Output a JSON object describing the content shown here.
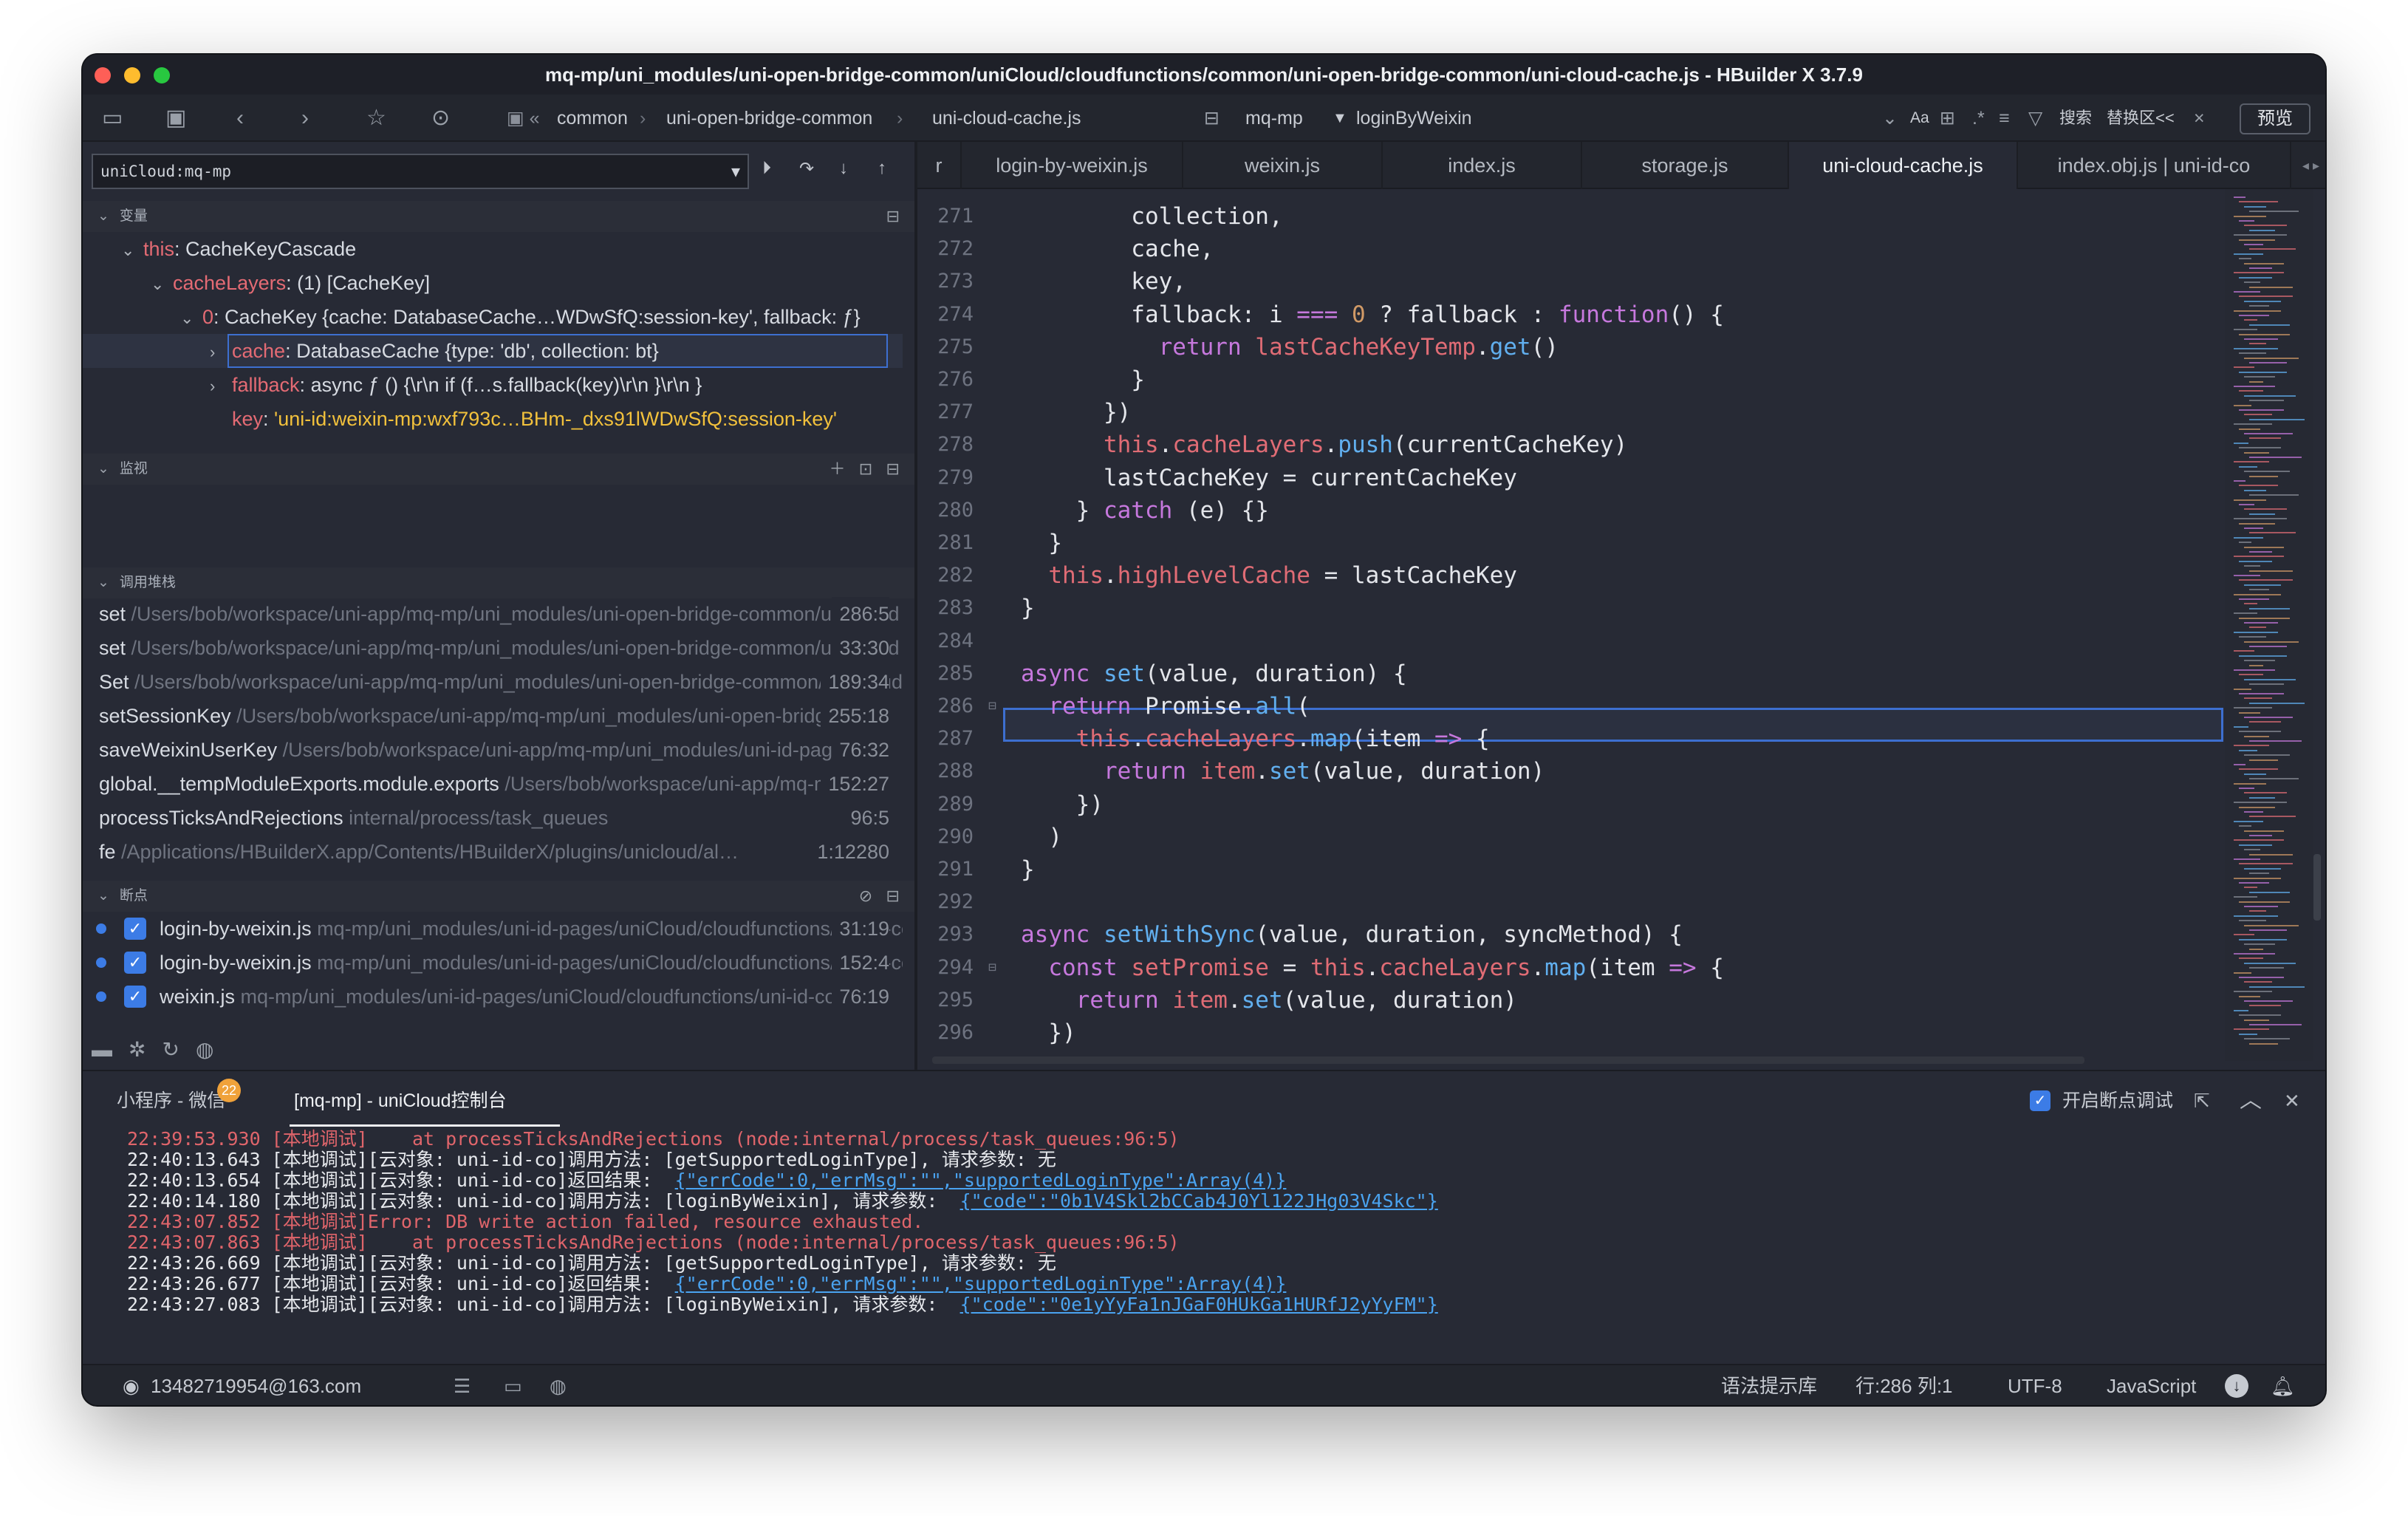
{
  "window": {
    "title": "mq-mp/uni_modules/uni-open-bridge-common/uniCloud/cloudfunctions/common/uni-open-bridge-common/uni-cloud-cache.js - HBuilder X 3.7.9"
  },
  "toolbar": {
    "breadcrumb": [
      "common",
      "uni-open-bridge-common",
      "uni-cloud-cache.js"
    ],
    "project": "mq-mp",
    "function": "loginByWeixin",
    "search_label": "搜索",
    "replace_label": "替换区<<",
    "preview_label": "预览",
    "font_label": "Aa"
  },
  "debug": {
    "target": "uniCloud:mq-mp",
    "sections": {
      "variables": "变量",
      "watch": "监视",
      "callstack": "调用堆栈",
      "breakpoints": "断点"
    },
    "variables": [
      {
        "key": "this",
        "val": "CacheKeyCascade",
        "indent": 0,
        "tw": "v"
      },
      {
        "key": "cacheLayers",
        "val": "(1) [CacheKey]",
        "indent": 1,
        "tw": "v"
      },
      {
        "key": "0",
        "val": "CacheKey {cache: DatabaseCache…WDwSfQ:session-key', fallback: ƒ}",
        "indent": 2,
        "tw": "v"
      },
      {
        "key": "cache",
        "val": "DatabaseCache {type: 'db', collection: bt}",
        "indent": 3,
        "tw": ">"
      },
      {
        "key": "fallback",
        "val": "async ƒ () {\\r\\n        if (f…s.fallback(key)\\r\\n        }\\r\\n      }",
        "indent": 3,
        "tw": ">"
      },
      {
        "key": "key",
        "val": "'uni-id:weixin-mp:wxf793c…BHm-_dxs91lWDwSfQ:session-key'",
        "indent": 3,
        "tw": ""
      }
    ],
    "callstack": [
      {
        "fn": "set",
        "path": "/Users/bob/workspace/uni-app/mq-mp/uni_modules/uni-open-bridge-common/uniCloud",
        "loc": "286:5"
      },
      {
        "fn": "set",
        "path": "/Users/bob/workspace/uni-app/mq-mp/uni_modules/uni-open-bridge-common/uniCloud",
        "loc": "33:30"
      },
      {
        "fn": "Set",
        "path": "/Users/bob/workspace/uni-app/mq-mp/uni_modules/uni-open-bridge-common/uniCloud",
        "loc": "189:34"
      },
      {
        "fn": "setSessionKey",
        "path": "/Users/bob/workspace/uni-app/mq-mp/uni_modules/uni-open-bridge",
        "loc": "255:18"
      },
      {
        "fn": "saveWeixinUserKey",
        "path": "/Users/bob/workspace/uni-app/mq-mp/uni_modules/uni-id-pages",
        "loc": "76:32"
      },
      {
        "fn": "global.__tempModuleExports.module.exports",
        "path": "/Users/bob/workspace/uni-app/mq-mp",
        "loc": "152:27"
      },
      {
        "fn": "processTicksAndRejections",
        "path": "internal/process/task_queues",
        "loc": "96:5"
      },
      {
        "fn": "fe",
        "path": "/Applications/HBuilderX.app/Contents/HBuilderX/plugins/unicloud/al…",
        "loc": "1:12280"
      }
    ],
    "breakpoints": [
      {
        "name": "login-by-weixin.js",
        "path": "mq-mp/uni_modules/uni-id-pages/uniCloud/cloudfunctions/uni-id-co",
        "loc": "31:19"
      },
      {
        "name": "login-by-weixin.js",
        "path": "mq-mp/uni_modules/uni-id-pages/uniCloud/cloudfunctions/uni-id-co",
        "loc": "152:4"
      },
      {
        "name": "weixin.js",
        "path": "mq-mp/uni_modules/uni-id-pages/uniCloud/cloudfunctions/uni-id-co",
        "loc": "76:19"
      }
    ]
  },
  "tabs": [
    {
      "label": "r",
      "active": false
    },
    {
      "label": "login-by-weixin.js",
      "active": false
    },
    {
      "label": "weixin.js",
      "active": false
    },
    {
      "label": "index.js",
      "active": false
    },
    {
      "label": "storage.js",
      "active": false
    },
    {
      "label": "uni-cloud-cache.js",
      "active": true
    },
    {
      "label": "index.obj.js | uni-id-co",
      "active": false
    }
  ],
  "editor": {
    "current_line": 286,
    "lines": [
      {
        "n": 271,
        "t": [
          [
            "        collection,",
            ""
          ]
        ]
      },
      {
        "n": 272,
        "t": [
          [
            "        cache,",
            ""
          ]
        ]
      },
      {
        "n": 273,
        "t": [
          [
            "        key,",
            ""
          ]
        ]
      },
      {
        "n": 274,
        "t": [
          [
            "        fallback: i ",
            ""
          ],
          [
            "===",
            "kw"
          ],
          [
            " ",
            ""
          ],
          [
            "0",
            "num"
          ],
          [
            " ? fallback : ",
            ""
          ],
          [
            "function",
            "kw"
          ],
          [
            "() {",
            ""
          ]
        ]
      },
      {
        "n": 275,
        "t": [
          [
            "          ",
            ""
          ],
          [
            "return",
            "kw"
          ],
          [
            " ",
            ""
          ],
          [
            "lastCacheKeyTemp",
            "prp"
          ],
          [
            ".",
            ""
          ],
          [
            "get",
            "fnc"
          ],
          [
            "()",
            ""
          ]
        ]
      },
      {
        "n": 276,
        "t": [
          [
            "        }",
            ""
          ]
        ]
      },
      {
        "n": 277,
        "t": [
          [
            "      })",
            ""
          ]
        ]
      },
      {
        "n": 278,
        "t": [
          [
            "      ",
            ""
          ],
          [
            "this",
            "prp"
          ],
          [
            ".",
            ""
          ],
          [
            "cacheLayers",
            "prp"
          ],
          [
            ".",
            ""
          ],
          [
            "push",
            "fnc"
          ],
          [
            "(currentCacheKey)",
            ""
          ]
        ]
      },
      {
        "n": 279,
        "t": [
          [
            "      lastCacheKey = currentCacheKey",
            ""
          ]
        ]
      },
      {
        "n": 280,
        "t": [
          [
            "    } ",
            ""
          ],
          [
            "catch",
            "kw"
          ],
          [
            " (e) {}",
            ""
          ]
        ]
      },
      {
        "n": 281,
        "t": [
          [
            "  }",
            ""
          ]
        ]
      },
      {
        "n": 282,
        "t": [
          [
            "  ",
            ""
          ],
          [
            "this",
            "prp"
          ],
          [
            ".",
            ""
          ],
          [
            "highLevelCache",
            "prp"
          ],
          [
            " = lastCacheKey",
            ""
          ]
        ]
      },
      {
        "n": 283,
        "t": [
          [
            "}",
            ""
          ]
        ]
      },
      {
        "n": 284,
        "t": [
          [
            "",
            ""
          ]
        ]
      },
      {
        "n": 285,
        "t": [
          [
            "async",
            "kw"
          ],
          [
            " ",
            ""
          ],
          [
            "set",
            "fnc"
          ],
          [
            "(value, duration) {",
            ""
          ]
        ]
      },
      {
        "n": 286,
        "t": [
          [
            "  ",
            ""
          ],
          [
            "return",
            "kw"
          ],
          [
            " Promise.",
            ""
          ],
          [
            "all",
            "fnc"
          ],
          [
            "(",
            ""
          ]
        ]
      },
      {
        "n": 287,
        "t": [
          [
            "    ",
            ""
          ],
          [
            "this",
            "prp"
          ],
          [
            ".",
            ""
          ],
          [
            "cacheLayers",
            "prp"
          ],
          [
            ".",
            ""
          ],
          [
            "map",
            "fnc"
          ],
          [
            "(item ",
            ""
          ],
          [
            "=>",
            "kw"
          ],
          [
            " {",
            ""
          ]
        ]
      },
      {
        "n": 288,
        "t": [
          [
            "      ",
            ""
          ],
          [
            "return",
            "kw"
          ],
          [
            " ",
            ""
          ],
          [
            "item",
            "prp"
          ],
          [
            ".",
            ""
          ],
          [
            "set",
            "fnc"
          ],
          [
            "(value, duration)",
            ""
          ]
        ]
      },
      {
        "n": 289,
        "t": [
          [
            "    })",
            ""
          ]
        ]
      },
      {
        "n": 290,
        "t": [
          [
            "  )",
            ""
          ]
        ]
      },
      {
        "n": 291,
        "t": [
          [
            "}",
            ""
          ]
        ]
      },
      {
        "n": 292,
        "t": [
          [
            "",
            ""
          ]
        ]
      },
      {
        "n": 293,
        "t": [
          [
            "async",
            "kw"
          ],
          [
            " ",
            ""
          ],
          [
            "setWithSync",
            "fnc"
          ],
          [
            "(value, duration, syncMethod) {",
            ""
          ]
        ]
      },
      {
        "n": 294,
        "t": [
          [
            "  ",
            ""
          ],
          [
            "const",
            "kw"
          ],
          [
            " ",
            ""
          ],
          [
            "setPromise",
            "prp"
          ],
          [
            " = ",
            ""
          ],
          [
            "this",
            "prp"
          ],
          [
            ".",
            ""
          ],
          [
            "cacheLayers",
            "prp"
          ],
          [
            ".",
            ""
          ],
          [
            "map",
            "fnc"
          ],
          [
            "(item ",
            ""
          ],
          [
            "=>",
            "kw"
          ],
          [
            " {",
            ""
          ]
        ]
      },
      {
        "n": 295,
        "t": [
          [
            "    ",
            ""
          ],
          [
            "return",
            "kw"
          ],
          [
            " ",
            ""
          ],
          [
            "item",
            "prp"
          ],
          [
            ".",
            ""
          ],
          [
            "set",
            "fnc"
          ],
          [
            "(value, duration)",
            ""
          ]
        ]
      },
      {
        "n": 296,
        "t": [
          [
            "  })",
            ""
          ]
        ]
      }
    ]
  },
  "console": {
    "tab_miniprogram": "小程序 - 微信",
    "tab_miniprogram_badge": "22",
    "tab_cloud": "[mq-mp] - uniCloud控制台",
    "breakpoint_debug_label": "开启断点调试",
    "logs": [
      {
        "err": true,
        "text": "22:39:53.930 [本地调试]    at processTicksAndRejections (node:internal/process/task_queues:96:5)",
        "link": ""
      },
      {
        "err": false,
        "text": "22:40:13.643 [本地调试][云对象: uni-id-co]调用方法: [getSupportedLoginType], 请求参数: 无",
        "link": ""
      },
      {
        "err": false,
        "text": "22:40:13.654 [本地调试][云对象: uni-id-co]返回结果:  ",
        "link": "{\"errCode\":0,\"errMsg\":\"\",\"supportedLoginType\":Array(4)}"
      },
      {
        "err": false,
        "text": "22:40:14.180 [本地调试][云对象: uni-id-co]调用方法: [loginByWeixin], 请求参数:  ",
        "link": "{\"code\":\"0b1V4Skl2bCCab4J0Yl122JHg03V4Skc\"}"
      },
      {
        "err": true,
        "text": "22:43:07.852 [本地调试]Error: DB write action failed, resource exhausted.",
        "link": ""
      },
      {
        "err": true,
        "text": "22:43:07.863 [本地调试]    at processTicksAndRejections (node:internal/process/task_queues:96:5)",
        "link": ""
      },
      {
        "err": false,
        "text": "22:43:26.669 [本地调试][云对象: uni-id-co]调用方法: [getSupportedLoginType], 请求参数: 无",
        "link": ""
      },
      {
        "err": false,
        "text": "22:43:26.677 [本地调试][云对象: uni-id-co]返回结果:  ",
        "link": "{\"errCode\":0,\"errMsg\":\"\",\"supportedLoginType\":Array(4)}"
      },
      {
        "err": false,
        "text": "22:43:27.083 [本地调试][云对象: uni-id-co]调用方法: [loginByWeixin], 请求参数:  ",
        "link": "{\"code\":\"0e1yYyFa1nJGaF0HUkGa1HURfJ2yYyFM\"}"
      }
    ]
  },
  "status": {
    "user": "13482719954@163.com",
    "syntax_lib": "语法提示库",
    "position": "行:286  列:1",
    "encoding": "UTF-8",
    "language": "JavaScript"
  },
  "colors": {
    "accent": "#3c7ce6",
    "error": "#e0656b",
    "keyword": "#c678dd",
    "function": "#61afef",
    "property": "#e06c75"
  }
}
